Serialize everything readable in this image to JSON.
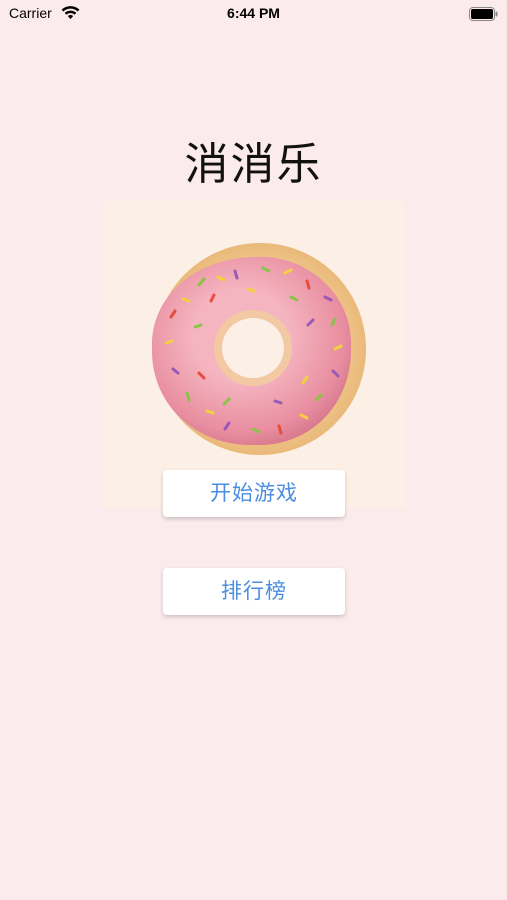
{
  "status_bar": {
    "carrier": "Carrier",
    "time": "6:44 PM",
    "wifi_icon": "wifi-icon",
    "battery_icon": "battery-full-icon"
  },
  "app": {
    "title": "消消乐",
    "hero_image": "pink-frosted-donut-with-sprinkles",
    "background_color": "#fbebec",
    "accent_color": "#4b8ee0"
  },
  "buttons": {
    "start_game": "开始游戏",
    "leaderboard": "排行榜"
  }
}
